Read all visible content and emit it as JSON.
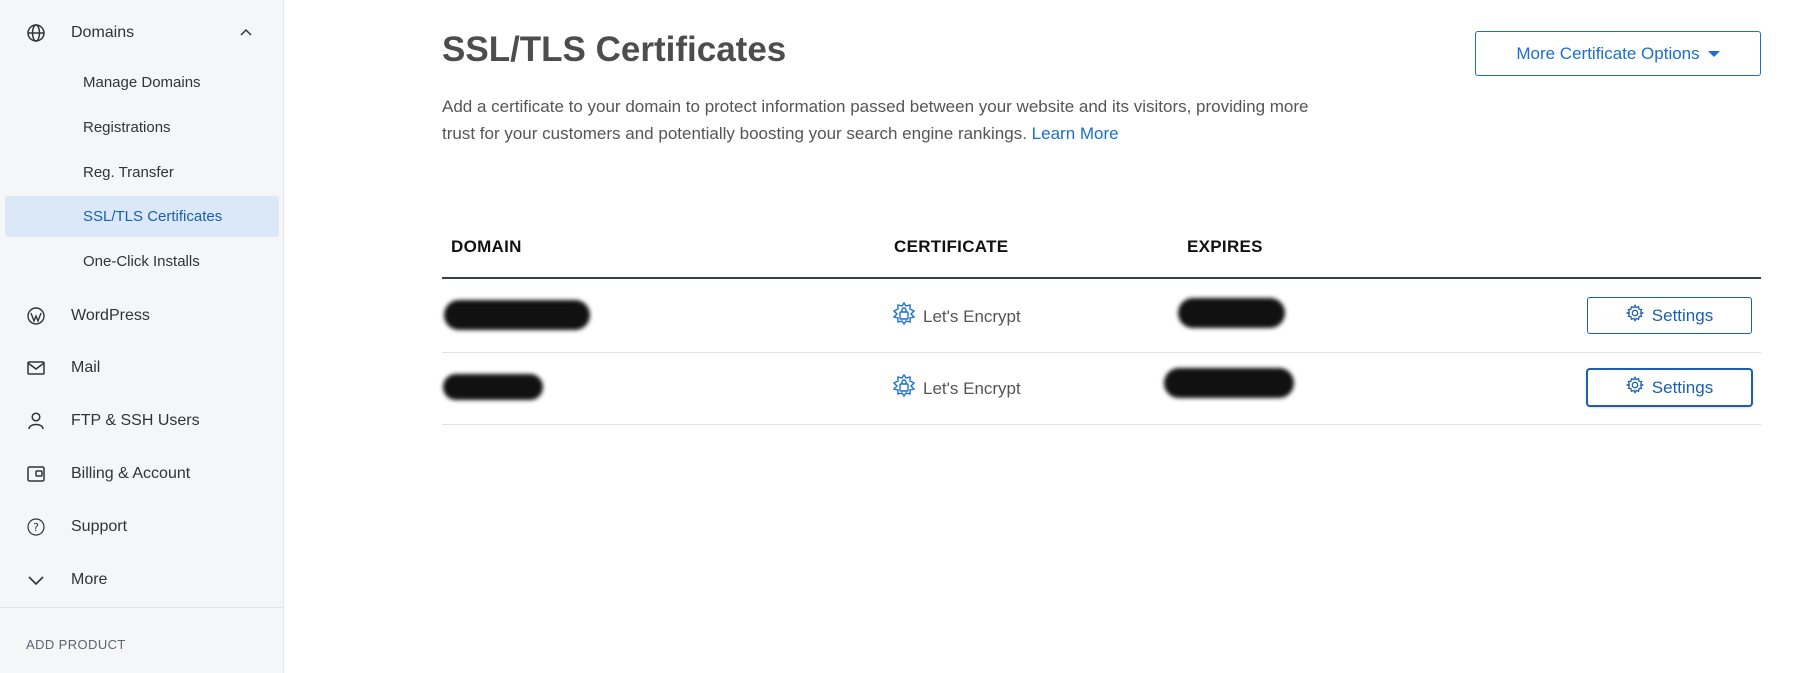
{
  "sidebar": {
    "domains": {
      "label": "Domains",
      "icon": "globe-icon",
      "expanded": true
    },
    "sub_items": [
      {
        "label": "Manage Domains",
        "active": false
      },
      {
        "label": "Registrations",
        "active": false
      },
      {
        "label": "Reg. Transfer",
        "active": false
      },
      {
        "label": "SSL/TLS Certificates",
        "active": true
      },
      {
        "label": "One-Click Installs",
        "active": false
      }
    ],
    "items": [
      {
        "label": "WordPress",
        "icon": "wordpress-icon"
      },
      {
        "label": "Mail",
        "icon": "mail-icon"
      },
      {
        "label": "FTP & SSH Users",
        "icon": "user-icon"
      },
      {
        "label": "Billing & Account",
        "icon": "wallet-icon"
      },
      {
        "label": "Support",
        "icon": "help-icon"
      },
      {
        "label": "More",
        "icon": "chevron-down-icon"
      }
    ],
    "add_product": "ADD PRODUCT"
  },
  "page": {
    "title": "SSL/TLS Certificates",
    "description": "Add a certificate to your domain to protect information passed between your website and its visitors, providing more trust for your customers and potentially boosting your search engine rankings.",
    "learn_more": "Learn More",
    "options_button": "More Certificate Options"
  },
  "table": {
    "headers": {
      "domain": "DOMAIN",
      "certificate": "CERTIFICATE",
      "expires": "EXPIRES"
    },
    "rows": [
      {
        "domain": "[redacted]",
        "certificate": "Let's Encrypt",
        "expires": "[redacted]",
        "action": "Settings"
      },
      {
        "domain": "[redacted]",
        "certificate": "Let's Encrypt",
        "expires": "[redacted]",
        "action": "Settings"
      }
    ]
  },
  "colors": {
    "accent": "#1a6fd1",
    "active_bg": "#dbe8f8",
    "sidebar_bg": "#f4f6f8"
  }
}
